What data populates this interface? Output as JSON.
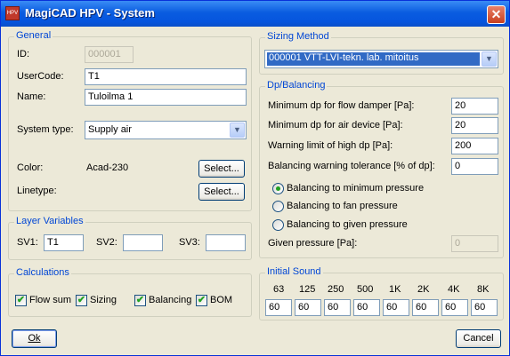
{
  "window": {
    "title": "MagiCAD HPV - System",
    "icon_name": "magicad-app-icon",
    "close_glyph": "✕"
  },
  "general": {
    "title": "General",
    "id_label": "ID:",
    "id_value": "000001",
    "usercode_label": "UserCode:",
    "usercode_value": "T1",
    "name_label": "Name:",
    "name_value": "Tuloilma 1",
    "systemtype_label": "System type:",
    "systemtype_value": "Supply air",
    "color_label": "Color:",
    "color_value": "Acad-230",
    "linetype_label": "Linetype:",
    "select_label": "Select..."
  },
  "layer_variables": {
    "title": "Layer Variables",
    "sv1_label": "SV1:",
    "sv1_value": "T1",
    "sv2_label": "SV2:",
    "sv2_value": "",
    "sv3_label": "SV3:",
    "sv3_value": ""
  },
  "calculations": {
    "title": "Calculations",
    "items": [
      {
        "label": "Flow sum",
        "checked": true
      },
      {
        "label": "Sizing",
        "checked": true
      },
      {
        "label": "Balancing",
        "checked": true
      },
      {
        "label": "BOM",
        "checked": true
      }
    ]
  },
  "sizing_method": {
    "title": "Sizing Method",
    "value": "000001   VTT-LVI-tekn. lab. mitoitus"
  },
  "dp_balancing": {
    "title": "Dp/Balancing",
    "flow_damper_label": "Minimum dp for flow damper [Pa]:",
    "flow_damper_value": "20",
    "air_device_label": "Minimum dp for air device [Pa]:",
    "air_device_value": "20",
    "warning_high_label": "Warning limit of high dp [Pa]:",
    "warning_high_value": "200",
    "tolerance_label": "Balancing warning tolerance [% of dp]:",
    "tolerance_value": "0",
    "radio_min": "Balancing to minimum pressure",
    "radio_fan": "Balancing to fan pressure",
    "radio_given": "Balancing to given pressure",
    "radio_selected": "min",
    "given_label": "Given pressure [Pa]:",
    "given_value": "0"
  },
  "initial_sound": {
    "title": "Initial Sound",
    "bands": [
      "63",
      "125",
      "250",
      "500",
      "1K",
      "2K",
      "4K",
      "8K"
    ],
    "values": [
      "60",
      "60",
      "60",
      "60",
      "60",
      "60",
      "60",
      "60"
    ]
  },
  "buttons": {
    "ok": "Ok",
    "cancel": "Cancel"
  }
}
